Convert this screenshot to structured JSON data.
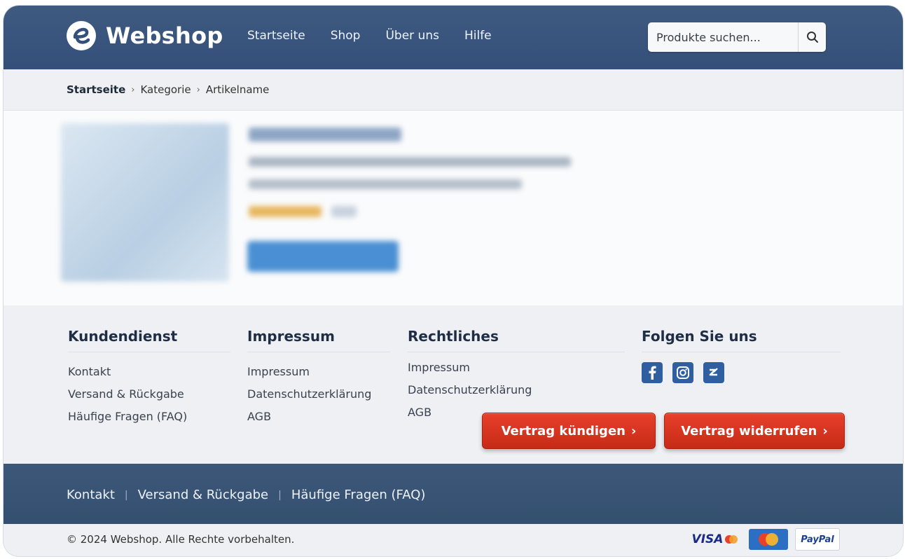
{
  "header": {
    "brand": "Webshop",
    "nav": [
      "Startseite",
      "Shop",
      "Über uns",
      "Hilfe"
    ],
    "search_placeholder": "Produkte suchen..."
  },
  "breadcrumb": [
    "Startseite",
    "Kategorie",
    "Artikelname"
  ],
  "footer_columns": [
    {
      "title": "Kundendienst",
      "items": [
        "Kontakt",
        "Versand & Rückgabe",
        "Häufige Fragen (FAQ)"
      ]
    },
    {
      "title": "Impressum",
      "items": [
        "Impressum",
        "Datenschutzerklärung",
        "AGB"
      ]
    },
    {
      "title": "Rechtliches",
      "items": [
        "Impressum",
        "Datenschutzerklärung",
        "AGB"
      ]
    },
    {
      "title": "Folgen Sie uns",
      "icons": [
        "facebook-icon",
        "instagram-icon",
        "xing-icon"
      ]
    }
  ],
  "actions": {
    "cancel_contract": "Vertrag kündigen",
    "revoke_contract": "Vertrag widerrufen"
  },
  "footer_nav": [
    "Kontakt",
    "Versand & Rückgabe",
    "Häufige Fragen (FAQ)"
  ],
  "copyright": "© 2024 Webshop. Alle Rechte vorbehalten.",
  "payment": [
    "VISA",
    "PayPal"
  ],
  "colors": {
    "header": "#3f5a80",
    "accent_red": "#d9361f",
    "social": "#2f5fa0"
  }
}
